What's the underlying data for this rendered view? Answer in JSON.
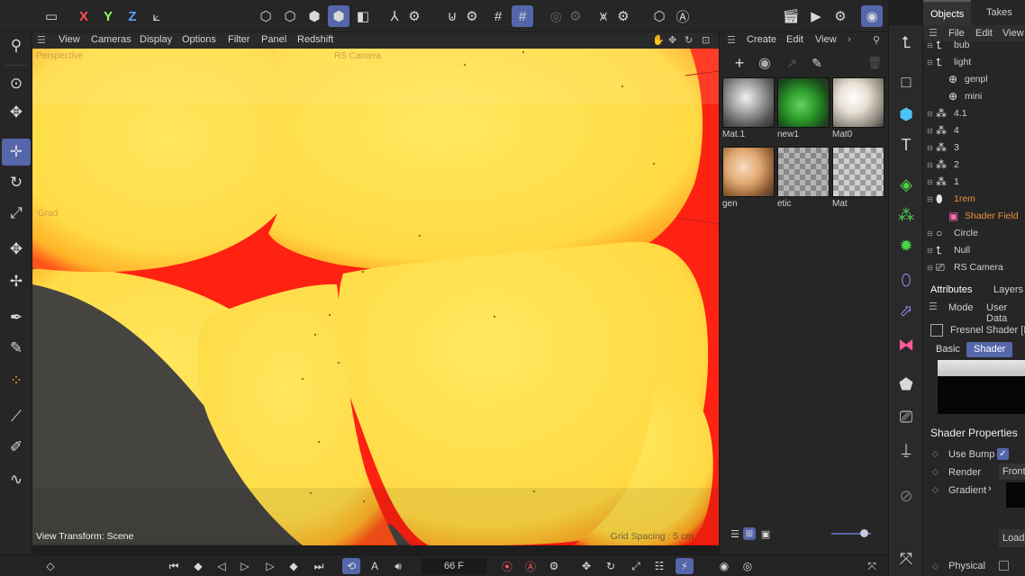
{
  "top_toolbar": {
    "axis_x": "X",
    "axis_y": "Y",
    "axis_z": "Z"
  },
  "viewport": {
    "menu": [
      "View",
      "Cameras",
      "Display",
      "Options",
      "Filter",
      "Panel",
      "Redshift"
    ],
    "camera_label": "Perspective",
    "rs_camera_label": "RS Camera",
    "overlay_label": "Grad",
    "view_transform": "View Transform: Scene",
    "grid_spacing": "Grid Spacing : 5 cm"
  },
  "materials": {
    "menu": [
      "Create",
      "Edit",
      "View"
    ],
    "items": [
      {
        "name": "Mat.1",
        "kind": "glass"
      },
      {
        "name": "new1",
        "kind": "green"
      },
      {
        "name": "Mat0",
        "kind": "white"
      },
      {
        "name": "gen",
        "kind": "skin"
      },
      {
        "name": "etic",
        "kind": "pattern"
      },
      {
        "name": "Mat",
        "kind": "checker"
      }
    ]
  },
  "objects_panel": {
    "tabs": [
      "Objects",
      "Takes"
    ],
    "menu": [
      "File",
      "Edit",
      "View"
    ],
    "tree": [
      {
        "label": "bub",
        "icon": "null-icon",
        "indent": 1,
        "highlight": false
      },
      {
        "label": "light",
        "icon": "light-icon",
        "indent": 1,
        "highlight": false
      },
      {
        "label": "genpl",
        "icon": "globe-icon",
        "indent": 2,
        "highlight": false
      },
      {
        "label": "mini",
        "icon": "globe-icon",
        "indent": 2,
        "highlight": false
      },
      {
        "label": "4.1",
        "icon": "cloner-icon",
        "indent": 1,
        "highlight": false
      },
      {
        "label": "4",
        "icon": "cloner-icon",
        "indent": 1,
        "highlight": false
      },
      {
        "label": "3",
        "icon": "cloner-icon",
        "indent": 1,
        "highlight": false
      },
      {
        "label": "2",
        "icon": "cloner-icon",
        "indent": 1,
        "highlight": false
      },
      {
        "label": "1",
        "icon": "cloner-icon",
        "indent": 1,
        "highlight": false
      },
      {
        "label": "1rem",
        "icon": "volume-icon",
        "indent": 1,
        "highlight": true
      },
      {
        "label": "Shader Field",
        "icon": "shader-field-icon",
        "indent": 2,
        "highlight": true
      },
      {
        "label": "Circle",
        "icon": "circle-icon",
        "indent": 1,
        "highlight": false
      },
      {
        "label": "Null",
        "icon": "null-icon",
        "indent": 1,
        "highlight": false
      },
      {
        "label": "RS Camera",
        "icon": "camera-icon",
        "indent": 1,
        "highlight": false
      }
    ]
  },
  "attributes": {
    "tabs": [
      "Attributes",
      "Layers"
    ],
    "menu": [
      "Mode",
      "User Data"
    ],
    "object_title": "Fresnel Shader [Fr",
    "subtabs": [
      "Basic",
      "Shader"
    ],
    "section_title": "Shader Properties",
    "use_bump_label": "Use Bump",
    "render_label": "Render",
    "render_value": "Front",
    "gradient_label": "Gradient",
    "physical_label": "Physical",
    "load_button": "Load"
  },
  "timeline": {
    "current_frame": "66 F"
  },
  "colors": {
    "accent": "#5566aa",
    "highlight": "#e8923c",
    "viewport_yellow": "#ffe14a",
    "viewport_red": "#ff1a0a"
  }
}
